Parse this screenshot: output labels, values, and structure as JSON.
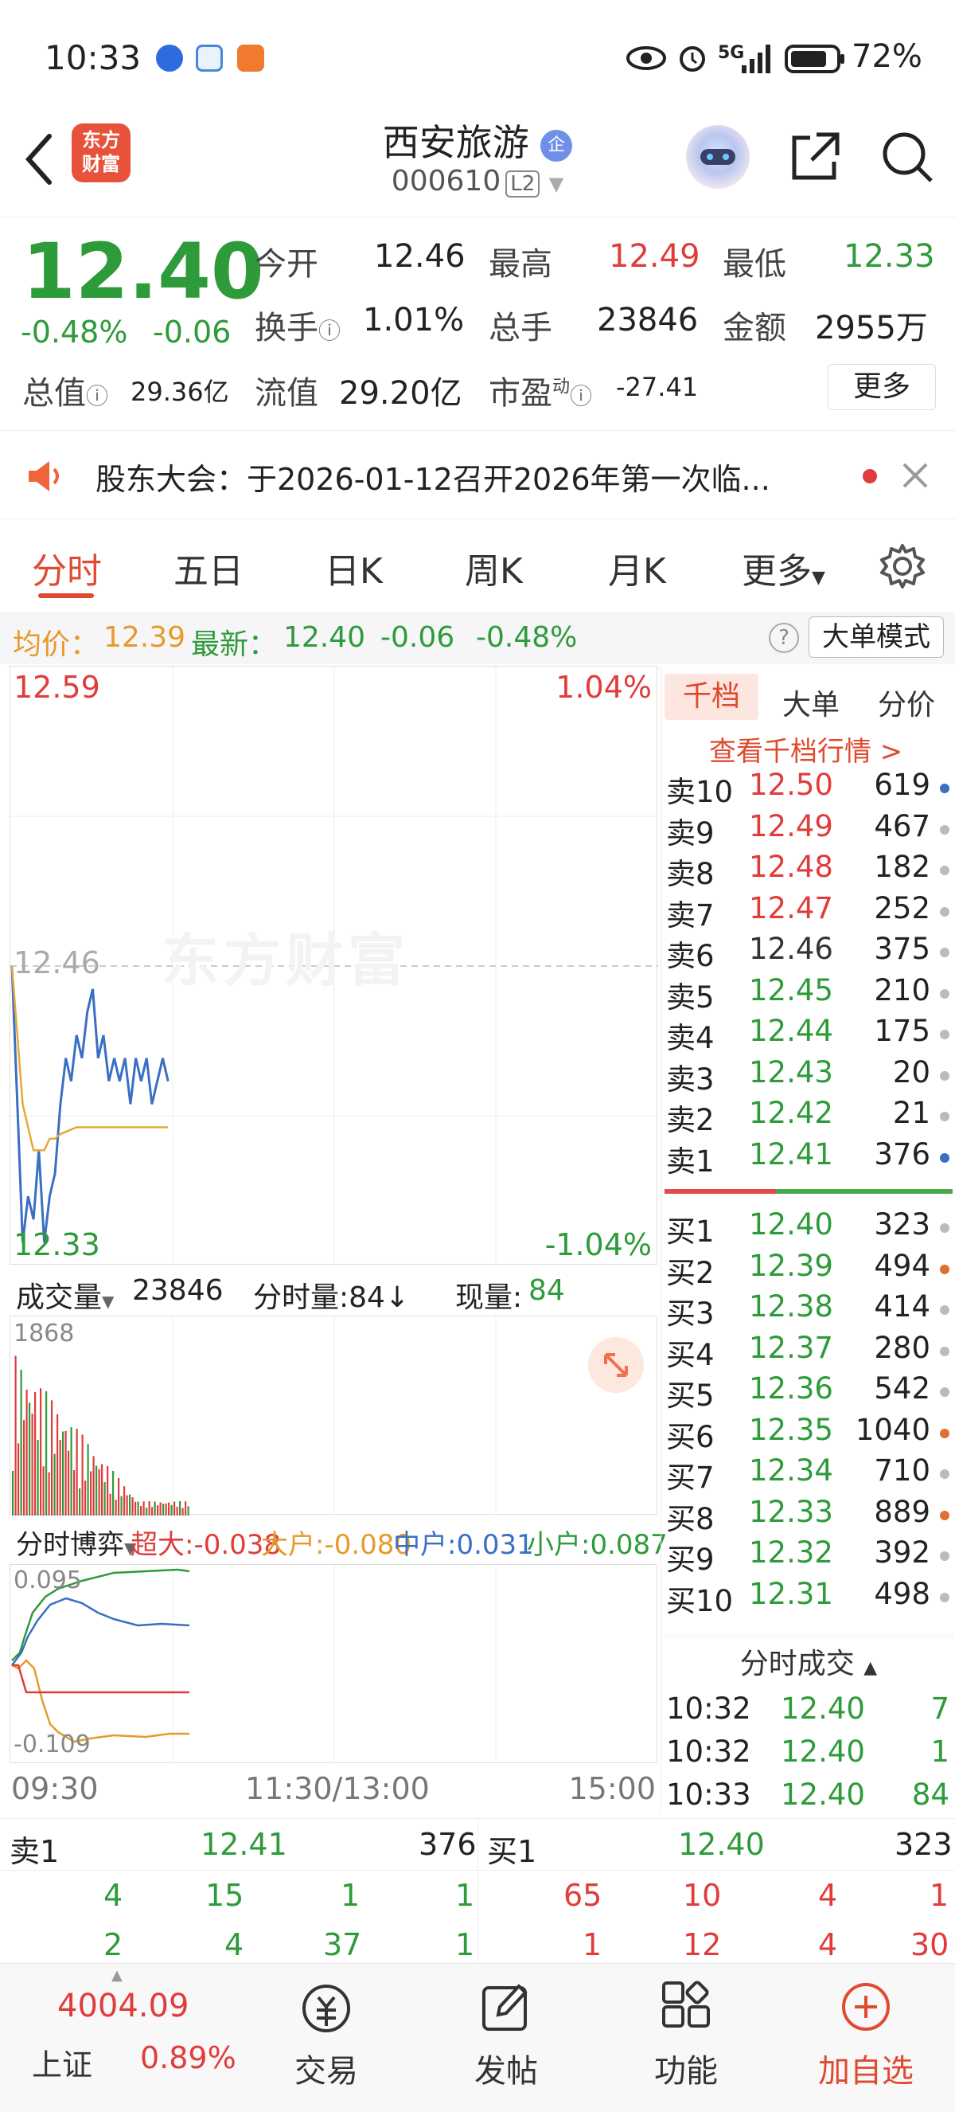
{
  "status_bar": {
    "time": "10:33",
    "signal": "5G",
    "battery": "72%"
  },
  "header": {
    "logo_line1": "东方",
    "logo_line2": "财富",
    "stock_name": "西安旅游",
    "name_badge": "企",
    "stock_code": "000610",
    "level_badge": "L2"
  },
  "quote": {
    "price": "12.40",
    "change_pct": "-0.48%",
    "change_amt": "-0.06",
    "open_label": "今开",
    "open": "12.46",
    "high_label": "最高",
    "high": "12.49",
    "low_label": "最低",
    "low": "12.33",
    "turnover_label": "换手",
    "turnover": "1.01%",
    "volume_label": "总手",
    "volume": "23846",
    "amount_label": "金额",
    "amount": "2955万",
    "mktcap_label": "总值",
    "mktcap": "29.36亿",
    "float_label": "流值",
    "float_cap": "29.20亿",
    "pe_label": "市盈",
    "pe_sup": "动",
    "pe": "-27.41",
    "more_button": "更多"
  },
  "notice": {
    "text": "股东大会：于2026-01-12召开2026年第一次临..."
  },
  "tabs": [
    "分时",
    "五日",
    "日K",
    "周K",
    "月K",
    "更多"
  ],
  "avg_line": {
    "avg_label": "均价：",
    "avg_value": "12.39",
    "latest_label": "最新：",
    "latest_value": "12.40",
    "change": "-0.06",
    "change_pct": "-0.48%",
    "big_order_button": "大单模式"
  },
  "chart": {
    "price_top": "12.59",
    "pct_top": "1.04%",
    "price_mid": "12.46",
    "price_bottom": "12.33",
    "pct_bottom": "-1.04%",
    "watermark": "东方财富",
    "volume_label": "成交量",
    "volume_total": "23846",
    "tick_vol_label": "分时量:84↓",
    "current_vol_label": "现量:",
    "current_vol": "84",
    "volume_max": "1868",
    "game_label": "分时博弈",
    "super_label": "超大:",
    "super_val": "-0.038",
    "big_label": "大户:",
    "big_val": "-0.080",
    "mid_label": "中户:",
    "mid_val": "0.031",
    "small_label": "小户:",
    "small_val": "0.087",
    "game_top": "0.095",
    "game_bottom": "-0.109",
    "time_start": "09:30",
    "time_mid": "11:30/13:00",
    "time_end": "15:00"
  },
  "chart_data": {
    "type": "line",
    "title": "",
    "xlabel": "",
    "ylabel": "",
    "ylim": [
      12.33,
      12.59
    ],
    "series": [
      {
        "name": "",
        "values": [
          12.46,
          12.4,
          12.34,
          12.36,
          12.35,
          12.38,
          12.34,
          12.36,
          12.37,
          12.4,
          12.42,
          12.41,
          12.43,
          12.42,
          12.44,
          12.45,
          12.42,
          12.43,
          12.41,
          12.42,
          12.41,
          12.42,
          12.4,
          12.42,
          12.41,
          12.42,
          12.4,
          12.41,
          12.42,
          12.41
        ]
      },
      {
        "name": "均价",
        "values": [
          12.46,
          12.43,
          12.4,
          12.39,
          12.38,
          12.38,
          12.38,
          12.385,
          12.385,
          12.387,
          12.388,
          12.389,
          12.39,
          12.39,
          12.39,
          12.39,
          12.39,
          12.39,
          12.39,
          12.39,
          12.39,
          12.39,
          12.39,
          12.39,
          12.39,
          12.39,
          12.39,
          12.39,
          12.39,
          12.39
        ]
      }
    ]
  },
  "order_book": {
    "tabs": [
      "千档",
      "大单",
      "分价"
    ],
    "view_more": "查看千档行情 >",
    "asks": [
      {
        "label": "卖10",
        "price": "12.50",
        "vol": "619",
        "dot": "#3a6fc4",
        "color": "#e03c3c"
      },
      {
        "label": "卖9",
        "price": "12.49",
        "vol": "467",
        "dot": "#bbbbbb",
        "color": "#e03c3c"
      },
      {
        "label": "卖8",
        "price": "12.48",
        "vol": "182",
        "dot": "#bbbbbb",
        "color": "#e03c3c"
      },
      {
        "label": "卖7",
        "price": "12.47",
        "vol": "252",
        "dot": "#bbbbbb",
        "color": "#e03c3c"
      },
      {
        "label": "卖6",
        "price": "12.46",
        "vol": "375",
        "dot": "#bbbbbb",
        "color": "#333333"
      },
      {
        "label": "卖5",
        "price": "12.45",
        "vol": "210",
        "dot": "#bbbbbb",
        "color": "#2e9b3a"
      },
      {
        "label": "卖4",
        "price": "12.44",
        "vol": "175",
        "dot": "#bbbbbb",
        "color": "#2e9b3a"
      },
      {
        "label": "卖3",
        "price": "12.43",
        "vol": "20",
        "dot": "#bbbbbb",
        "color": "#2e9b3a"
      },
      {
        "label": "卖2",
        "price": "12.42",
        "vol": "21",
        "dot": "#bbbbbb",
        "color": "#2e9b3a"
      },
      {
        "label": "卖1",
        "price": "12.41",
        "vol": "376",
        "dot": "#3a6fc4",
        "color": "#2e9b3a"
      }
    ],
    "bids": [
      {
        "label": "买1",
        "price": "12.40",
        "vol": "323",
        "dot": "#bbbbbb",
        "color": "#2e9b3a"
      },
      {
        "label": "买2",
        "price": "12.39",
        "vol": "494",
        "dot": "#e0702f",
        "color": "#2e9b3a"
      },
      {
        "label": "买3",
        "price": "12.38",
        "vol": "414",
        "dot": "#bbbbbb",
        "color": "#2e9b3a"
      },
      {
        "label": "买4",
        "price": "12.37",
        "vol": "280",
        "dot": "#bbbbbb",
        "color": "#2e9b3a"
      },
      {
        "label": "买5",
        "price": "12.36",
        "vol": "542",
        "dot": "#bbbbbb",
        "color": "#2e9b3a"
      },
      {
        "label": "买6",
        "price": "12.35",
        "vol": "1040",
        "dot": "#e0702f",
        "color": "#2e9b3a"
      },
      {
        "label": "买7",
        "price": "12.34",
        "vol": "710",
        "dot": "#bbbbbb",
        "color": "#2e9b3a"
      },
      {
        "label": "买8",
        "price": "12.33",
        "vol": "889",
        "dot": "#e0702f",
        "color": "#2e9b3a"
      },
      {
        "label": "买9",
        "price": "12.32",
        "vol": "392",
        "dot": "#bbbbbb",
        "color": "#2e9b3a"
      },
      {
        "label": "买10",
        "price": "12.31",
        "vol": "498",
        "dot": "#bbbbbb",
        "color": "#2e9b3a"
      }
    ],
    "trades_title": "分时成交",
    "trades": [
      {
        "time": "10:32",
        "price": "12.40",
        "vol": "7"
      },
      {
        "time": "10:32",
        "price": "12.40",
        "vol": "1"
      },
      {
        "time": "10:33",
        "price": "12.40",
        "vol": "84"
      }
    ]
  },
  "level1": {
    "ask_label": "卖1",
    "ask_price": "12.41",
    "ask_vol": "376",
    "bid_label": "买1",
    "bid_price": "12.40",
    "bid_vol": "323",
    "ask_row1": [
      "4",
      "15",
      "1",
      "1"
    ],
    "ask_row2": [
      "2",
      "4",
      "37",
      "1"
    ],
    "bid_row1": [
      "65",
      "10",
      "4",
      "1"
    ],
    "bid_row2": [
      "1",
      "12",
      "4",
      "30"
    ]
  },
  "bottom_nav": {
    "index_value": "4004.09",
    "index_name": "上证",
    "index_change": "0.89%",
    "trade": "交易",
    "post": "发帖",
    "features": "功能",
    "add_watch": "加自选"
  }
}
